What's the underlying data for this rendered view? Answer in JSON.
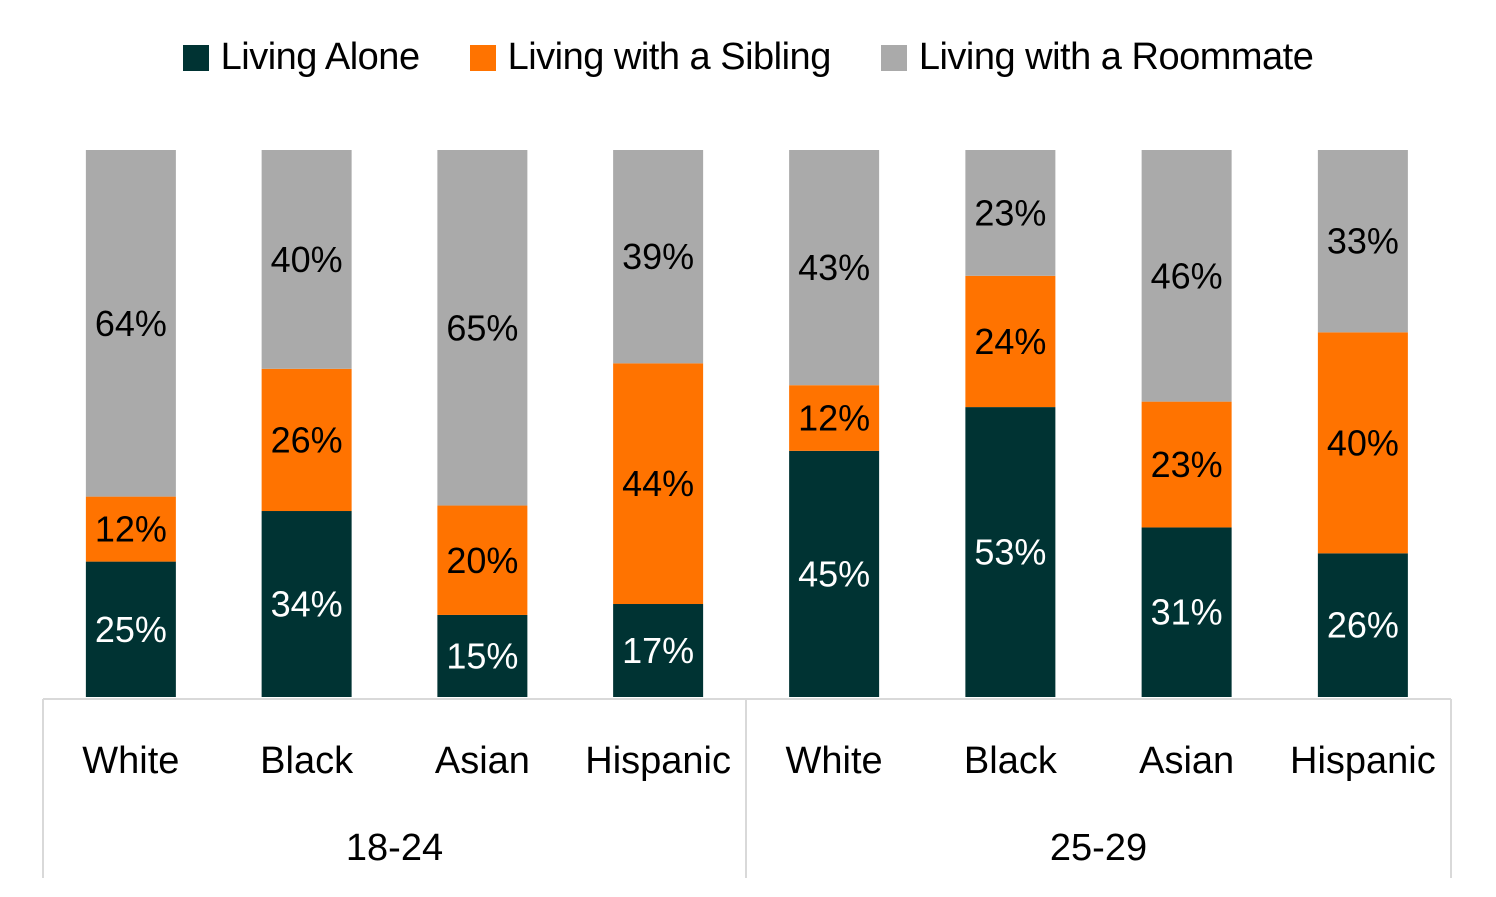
{
  "chart_data": {
    "type": "bar",
    "stacked": true,
    "percent_stacked": true,
    "title": "",
    "xlabel": "",
    "ylabel": "",
    "ylim": [
      0,
      100
    ],
    "grid": false,
    "legend_position": "top-center",
    "groups": [
      {
        "label": "18-24",
        "categories": [
          "White",
          "Black",
          "Asian",
          "Hispanic"
        ]
      },
      {
        "label": "25-29",
        "categories": [
          "White",
          "Black",
          "Asian",
          "Hispanic"
        ]
      }
    ],
    "categories": [
      "White",
      "Black",
      "Asian",
      "Hispanic",
      "White",
      "Black",
      "Asian",
      "Hispanic"
    ],
    "series": [
      {
        "name": "Living Alone",
        "color": "#003333",
        "label_color": "#ffffff",
        "values": [
          25,
          34,
          15,
          17,
          45,
          53,
          31,
          26
        ]
      },
      {
        "name": "Living with a Sibling",
        "color": "#ff7300",
        "label_color": "#000000",
        "values": [
          12,
          26,
          20,
          44,
          12,
          24,
          23,
          40
        ]
      },
      {
        "name": "Living with a Roommate",
        "color": "#aaaaaa",
        "label_color": "#000000",
        "values": [
          64,
          40,
          65,
          39,
          43,
          23,
          46,
          33
        ]
      }
    ],
    "value_suffix": "%"
  }
}
